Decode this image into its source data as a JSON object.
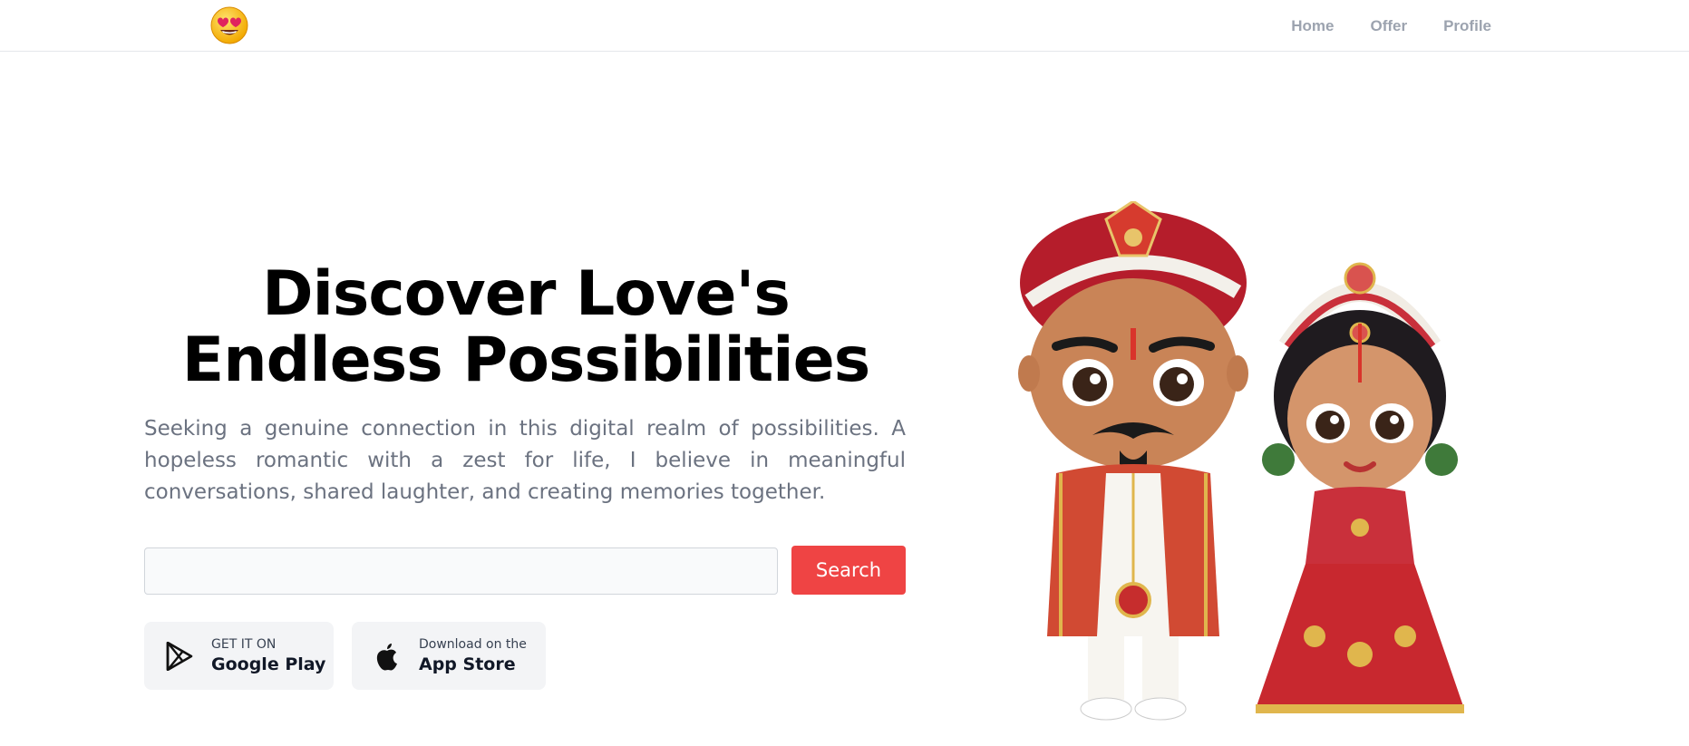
{
  "logo": {
    "icon": "heart-eyes-emoji-icon"
  },
  "nav": {
    "items": [
      {
        "label": "Home"
      },
      {
        "label": "Offer"
      },
      {
        "label": "Profile"
      }
    ]
  },
  "hero": {
    "title_line1": "Discover Love's",
    "title_line2": "Endless Possibilities",
    "description": "Seeking a genuine connection in this digital realm of possibilities. A hopeless romantic with a zest for life, I believe in meaningful conversations, shared laughter, and creating memories together."
  },
  "search": {
    "value": "",
    "placeholder": "",
    "button_label": "Search",
    "button_color": "#ef4444"
  },
  "stores": {
    "google": {
      "small": "GET IT ON",
      "big": "Google Play",
      "icon": "google-play-icon"
    },
    "apple": {
      "small": "Download on the",
      "big": "App Store",
      "icon": "apple-icon"
    }
  },
  "illustration": {
    "icon": "bride-and-groom-illustration"
  }
}
